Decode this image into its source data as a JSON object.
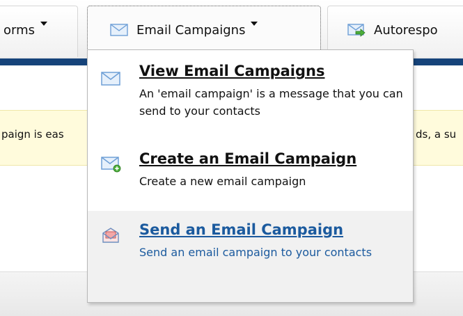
{
  "nav": {
    "tabs": [
      {
        "label": "orms",
        "icon": "caret-down-icon"
      },
      {
        "label": "Email Campaigns",
        "icon": "envelope-icon"
      },
      {
        "label": "Autorespo",
        "icon": "envelope-arrow-icon"
      }
    ]
  },
  "background": {
    "notice_left": "paign is eas",
    "notice_right": "ds, a su"
  },
  "menu": {
    "items": [
      {
        "title": "View Email Campaigns",
        "desc": "An 'email campaign' is a message that you can send to your contacts",
        "icon": "envelope-icon"
      },
      {
        "title": "Create an Email Campaign",
        "desc": "Create a new email campaign",
        "icon": "envelope-add-icon"
      },
      {
        "title": "Send an Email Campaign",
        "desc": "Send an email campaign to your contacts",
        "icon": "send-envelope-icon"
      }
    ]
  },
  "colors": {
    "nav_stripe": "#16437a",
    "link_hover": "#1b5a9e",
    "notice_bg": "#fffbdc"
  }
}
